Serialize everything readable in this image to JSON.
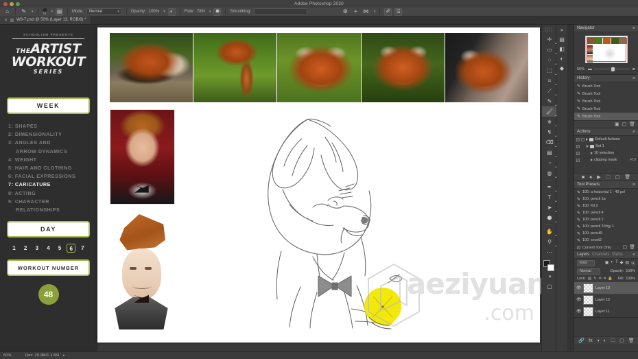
{
  "window": {
    "app_title": "Adobe Photoshop 2020",
    "traffic_lights": [
      "close",
      "minimize",
      "zoom"
    ]
  },
  "options_bar": {
    "home_icon": "home-icon",
    "tool_icon": "brush-tool-icon",
    "brush_preview_label": "",
    "brush_size_value": "11",
    "toggle_brush_panel_icon": "brush-panel-icon",
    "mode_label": "Mode:",
    "mode_value": "Normal",
    "opacity_label": "Opacity:",
    "opacity_value": "100%",
    "pressure_opacity_icon": "pressure-opacity-icon",
    "flow_label": "Flow:",
    "flow_value": "78%",
    "airbrush_icon": "airbrush-icon",
    "smoothing_label": "Smoothing:",
    "smoothing_value": "",
    "smoothing_settings_icon": "gear-icon",
    "angle_icon": "brush-angle-icon",
    "symmetry_icon": "symmetry-icon",
    "pressure_size_icon": "pressure-size-icon",
    "tablet_icon": "tablet-pressure-icon"
  },
  "doc_tab": {
    "title": "W6-7.psd @ 50% (Layer 13, RGB/8) *",
    "close_icon": "close-icon"
  },
  "course_panel": {
    "presents_text": "SCHOOLISM PRESENTS",
    "logo_the": "THE",
    "logo_artist": "ARTIST",
    "logo_workout": "WORKOUT",
    "logo_series": "SERIES",
    "week_button": "WEEK",
    "topics": [
      {
        "num": "1:",
        "label": "SHAPES",
        "cont": ""
      },
      {
        "num": "2:",
        "label": "DIMENSIONALITY",
        "cont": ""
      },
      {
        "num": "3:",
        "label": "ANGLES AND",
        "cont": "ARROW DYNAMICS"
      },
      {
        "num": "4:",
        "label": "WEIGHT",
        "cont": ""
      },
      {
        "num": "5:",
        "label": "HAIR AND CLOTHING",
        "cont": ""
      },
      {
        "num": "6:",
        "label": "FACIAL EXPRESSIONS",
        "cont": ""
      },
      {
        "num": "7:",
        "label": "CARICATURE",
        "cont": ""
      },
      {
        "num": "8:",
        "label": "ACTING",
        "cont": ""
      },
      {
        "num": "9:",
        "label": "CHARACTER",
        "cont": "RELATIONSHIPS"
      }
    ],
    "active_topic_index": 6,
    "day_button": "DAY",
    "days": [
      "1",
      "2",
      "3",
      "4",
      "5",
      "6",
      "7"
    ],
    "selected_day": "6",
    "workout_number_button": "WORKOUT NUMBER",
    "workout_number_value": "48",
    "accent_color": "#a8bd4f",
    "circle_color": "#8ba03a"
  },
  "canvas": {
    "reference_photos": [
      "red-panda-on-log",
      "red-panda-in-tree",
      "red-panda-face-closeup",
      "red-panda-portrait",
      "red-panda-looking-up"
    ],
    "reference_portrait": "conan-obrien-reference-photo",
    "caricature_study": "conan-obrien-caricature",
    "main_sketch": "red-panda-character-sketch",
    "sketch_highlight_color": "#f2e80a"
  },
  "watermark": {
    "logo_icon": "cube-logo-icon",
    "text": "aeziyuan",
    "suffix": ".com"
  },
  "toolbar": {
    "tools": [
      {
        "name": "move-tool",
        "glyph": "✛",
        "selected": false
      },
      {
        "name": "rectangular-marquee-tool",
        "glyph": "▭",
        "selected": false
      },
      {
        "name": "lasso-tool",
        "glyph": "◌",
        "selected": false
      },
      {
        "name": "object-selection-tool",
        "glyph": "⬚",
        "selected": false
      },
      {
        "name": "crop-tool",
        "glyph": "⌗",
        "selected": false
      },
      {
        "name": "eyedropper-tool",
        "glyph": "⟋",
        "selected": false
      },
      {
        "name": "spot-healing-brush-tool",
        "glyph": "✎",
        "selected": false
      },
      {
        "name": "brush-tool",
        "glyph": "🖌",
        "selected": true
      },
      {
        "name": "clone-stamp-tool",
        "glyph": "⎈",
        "selected": false
      },
      {
        "name": "history-brush-tool",
        "glyph": "↯",
        "selected": false
      },
      {
        "name": "eraser-tool",
        "glyph": "⌫",
        "selected": false
      },
      {
        "name": "gradient-tool",
        "glyph": "▤",
        "selected": false
      },
      {
        "name": "blur-tool",
        "glyph": "◔",
        "selected": false
      },
      {
        "name": "dodge-tool",
        "glyph": "◍",
        "selected": false
      },
      {
        "name": "pen-tool",
        "glyph": "✒",
        "selected": false
      },
      {
        "name": "type-tool",
        "glyph": "T",
        "selected": false
      },
      {
        "name": "path-selection-tool",
        "glyph": "➤",
        "selected": false
      },
      {
        "name": "shape-tool",
        "glyph": "⬢",
        "selected": false
      },
      {
        "name": "hand-tool",
        "glyph": "✋",
        "selected": false
      },
      {
        "name": "zoom-tool",
        "glyph": "⚲",
        "selected": false
      },
      {
        "name": "edit-toolbar-button",
        "glyph": "⋯",
        "selected": false
      }
    ],
    "foreground_color": "#1b1b1b",
    "background_color": "#ffffff",
    "quick_mask_icon": "quick-mask-icon",
    "screen_mode_icon": "screen-mode-icon"
  },
  "right_dock": {
    "navigator": {
      "title": "Navigator",
      "zoom_percent": "50%",
      "zoom_out_icon": "zoom-out-icon",
      "zoom_in_icon": "zoom-in-icon",
      "menu_icon": "panel-menu-icon"
    },
    "history": {
      "title": "History",
      "entries": [
        {
          "label": "Brush Tool",
          "icon": "brush-icon",
          "selected": false
        },
        {
          "label": "Brush Tool",
          "icon": "brush-icon",
          "selected": false
        },
        {
          "label": "Brush Tool",
          "icon": "brush-icon",
          "selected": false
        },
        {
          "label": "Brush Tool",
          "icon": "brush-icon",
          "selected": false
        },
        {
          "label": "Brush Tool",
          "icon": "brush-icon",
          "selected": true
        }
      ]
    },
    "actions": {
      "title": "Actions",
      "rows": [
        {
          "label": "Default Actions",
          "key": "",
          "kind": "set"
        },
        {
          "label": "Set 1",
          "key": "",
          "kind": "set"
        },
        {
          "label": "10 selection",
          "key": "",
          "kind": "action"
        },
        {
          "label": "clipping mask",
          "key": "F10",
          "kind": "action"
        }
      ],
      "footer_icons": [
        "stop-icon",
        "record-icon",
        "play-icon",
        "new-set-icon",
        "new-action-icon",
        "delete-icon"
      ]
    },
    "tool_presets": {
      "title": "Tool Presets",
      "entries": [
        "100: a hoizontal 1 - 40 pxl",
        "100: pencil 1a",
        "100: Kil 2",
        "100: pencil 4",
        "100: pencil 2",
        "100: pencil 3 lihjy 1",
        "100: pencil5",
        "100: secrit2"
      ],
      "current_tool_only": "Current Tool Only"
    },
    "layers": {
      "tabs": [
        "Layers",
        "Channels",
        "Paths"
      ],
      "active_tab": "Layers",
      "filter_value": "Kind",
      "blend_mode": "Normal",
      "opacity_label": "Opacity:",
      "opacity_value": "100%",
      "fill_label": "Fill:",
      "fill_value": "100%",
      "lock_label": "Lock:",
      "rows": [
        {
          "name": "Layer 13",
          "visible": true,
          "selected": true
        },
        {
          "name": "Layer 12",
          "visible": true,
          "selected": false
        },
        {
          "name": "Layer 11",
          "visible": true,
          "selected": false
        }
      ],
      "footer_icons": [
        "link-icon",
        "fx-icon",
        "mask-icon",
        "adjustment-icon",
        "group-icon",
        "new-layer-icon",
        "delete-icon"
      ]
    }
  },
  "status_bar": {
    "zoom": "50%",
    "doc_info": "Doc: 20.9M/1.1.5M",
    "arrow_icon": "status-arrow-icon"
  }
}
